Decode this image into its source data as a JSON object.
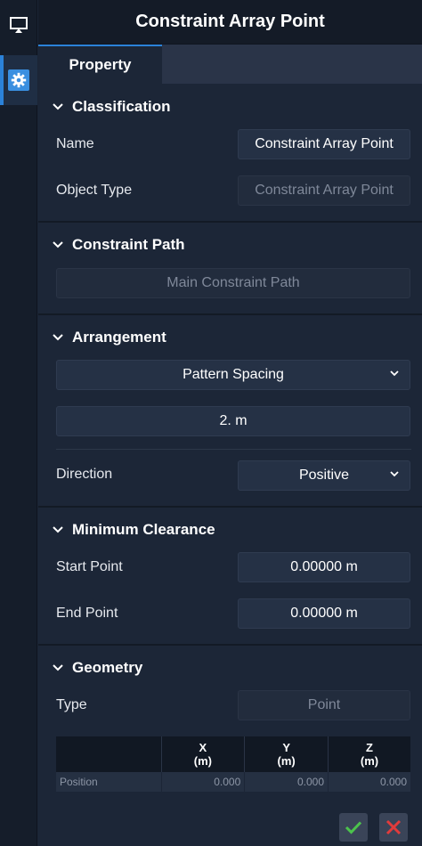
{
  "title": "Constraint Array Point",
  "tabs": [
    {
      "label": "Property"
    }
  ],
  "classification": {
    "header": "Classification",
    "name_label": "Name",
    "name_value": "Constraint Array Point",
    "object_type_label": "Object Type",
    "object_type_value": "Constraint Array Point"
  },
  "constraint_path": {
    "header": "Constraint Path",
    "value": "Main Constraint Path"
  },
  "arrangement": {
    "header": "Arrangement",
    "mode": "Pattern Spacing",
    "spacing": "2. m",
    "direction_label": "Direction",
    "direction_value": "Positive"
  },
  "minimum_clearance": {
    "header": "Minimum Clearance",
    "start_label": "Start Point",
    "start_value": "0.00000 m",
    "end_label": "End Point",
    "end_value": "0.00000 m"
  },
  "geometry": {
    "header": "Geometry",
    "type_label": "Type",
    "type_value": "Point",
    "columns": [
      {
        "axis": "X",
        "unit": "(m)"
      },
      {
        "axis": "Y",
        "unit": "(m)"
      },
      {
        "axis": "Z",
        "unit": "(m)"
      }
    ],
    "rows": [
      {
        "label": "Position",
        "x": "0.000",
        "y": "0.000",
        "z": "0.000"
      }
    ]
  },
  "icons": {
    "rail_top": "screen-icon",
    "rail_active": "gear-icon",
    "collapse": "chevron-down-icon",
    "ok": "check-icon",
    "cancel": "close-icon"
  },
  "colors": {
    "accent": "#2b82d9",
    "ok": "#4cc34c",
    "cancel": "#e23b3b"
  }
}
